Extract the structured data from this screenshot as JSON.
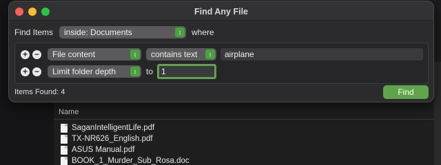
{
  "window": {
    "title": "Find Any File"
  },
  "search": {
    "find_items_label": "Find Items",
    "location_value": "inside: Documents",
    "where_label": "where"
  },
  "criteria": [
    {
      "attribute": "File content",
      "operator": "contains text",
      "value": "airplane"
    },
    {
      "attribute": "Limit folder depth",
      "to_label": "to",
      "value": "1"
    }
  ],
  "footer": {
    "items_found": "Items Found: 4",
    "find_label": "Find"
  },
  "results": {
    "column_name": "Name",
    "files": [
      "SaganIntelligentLife.pdf",
      "TX-NR626_English.pdf",
      "ASUS Manual.pdf",
      "BOOK_1_Murder_Sub_Rosa.doc"
    ]
  },
  "colors": {
    "accent_green": "#5fa44a",
    "close": "#fe5f57",
    "minimize": "#febc2e",
    "maximize": "#28c840"
  }
}
